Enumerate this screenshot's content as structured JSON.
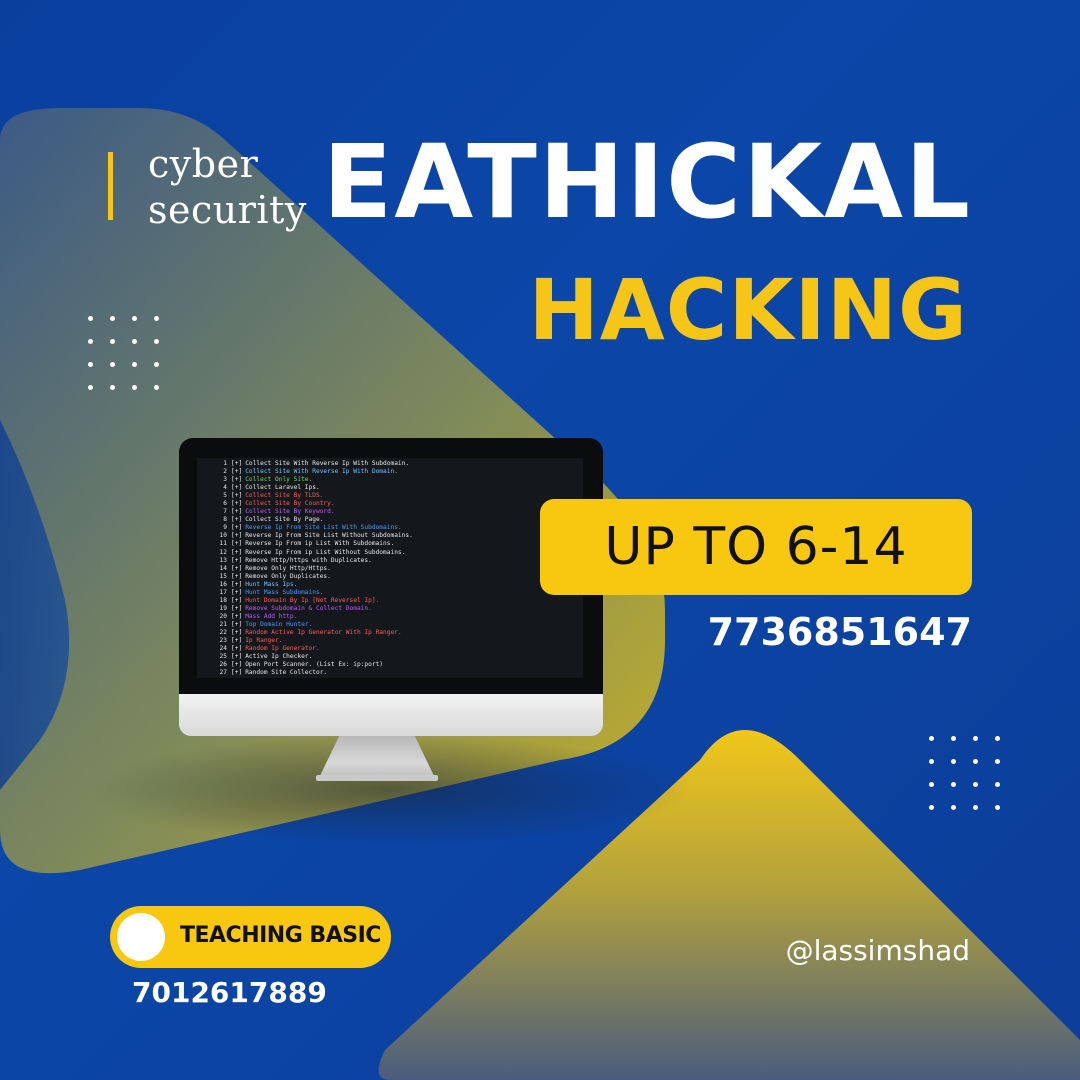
{
  "tagline": {
    "line1": "cyber",
    "line2": "security"
  },
  "title": {
    "line1": "EATHICKAL",
    "line2": "HACKING"
  },
  "age_badge": "UP TO 6-14",
  "phone_primary": "7736851647",
  "teaching_badge": "TEACHING BASIC",
  "phone_secondary": "7012617889",
  "handle": "@lassimshad",
  "colors": {
    "background_blue": "#0b47a8",
    "accent_yellow": "#f8c710",
    "text_white": "#ffffff"
  },
  "terminal": {
    "lines": [
      {
        "num": "1",
        "bracket": "[+]",
        "text": "Collect Site With Reverse Ip With Subdomain.",
        "color": "#e8e8e8"
      },
      {
        "num": "2",
        "bracket": "[+]",
        "text": "Collect Site With Reverse Ip With Domain.",
        "color": "#6ec6ff"
      },
      {
        "num": "3",
        "bracket": "[+]",
        "text": "Collect Only Site.",
        "color": "#7ed957"
      },
      {
        "num": "4",
        "bracket": "[+]",
        "text": "Collect Laravel Ips.",
        "color": "#e8e8e8"
      },
      {
        "num": "5",
        "bracket": "[+]",
        "text": "Collect Site By TLDS.",
        "color": "#ff5c5c"
      },
      {
        "num": "6",
        "bracket": "[+]",
        "text": "Collect Site By Country.",
        "color": "#ff5c5c"
      },
      {
        "num": "7",
        "bracket": "[+]",
        "text": "Collect Site By Keyword.",
        "color": "#c05cff"
      },
      {
        "num": "8",
        "bracket": "[+]",
        "text": "Collect Site By Page.",
        "color": "#e8e8e8"
      },
      {
        "num": "9",
        "bracket": "[+]",
        "text": "Reverse Ip From Site List With Subdomains.",
        "color": "#4a9bff"
      },
      {
        "num": "10",
        "bracket": "[+]",
        "text": "Reverse Ip From Site List Without Subdomains.",
        "color": "#e8e8e8"
      },
      {
        "num": "11",
        "bracket": "[+]",
        "text": "Reverse Ip From ip List With Subdomains.",
        "color": "#e8e8e8"
      },
      {
        "num": "12",
        "bracket": "[+]",
        "text": "Reverse Ip From ip List Without Subdomains.",
        "color": "#e8e8e8"
      },
      {
        "num": "13",
        "bracket": "[+]",
        "text": "Remove Http/https with Duplicates.",
        "color": "#e8e8e8"
      },
      {
        "num": "14",
        "bracket": "[+]",
        "text": "Remove Only Http/Https.",
        "color": "#e8e8e8"
      },
      {
        "num": "15",
        "bracket": "[+]",
        "text": "Remove Only Duplicates.",
        "color": "#e8e8e8"
      },
      {
        "num": "16",
        "bracket": "[+]",
        "text": "Hunt Mass Ips.",
        "color": "#6ec6ff"
      },
      {
        "num": "17",
        "bracket": "[+]",
        "text": "Hunt Mass Subdomains.",
        "color": "#4a9bff"
      },
      {
        "num": "18",
        "bracket": "[+]",
        "text": "Hunt Domain By Ip [Not Reversel Ip].",
        "color": "#ff5c5c"
      },
      {
        "num": "19",
        "bracket": "[+]",
        "text": "Remove Subdomain & Collect Domain.",
        "color": "#c05cff"
      },
      {
        "num": "20",
        "bracket": "[+]",
        "text": "Mass Add http.",
        "color": "#c05cff"
      },
      {
        "num": "21",
        "bracket": "[+]",
        "text": "Top Domain Hunter.",
        "color": "#4a9bff"
      },
      {
        "num": "22",
        "bracket": "[+]",
        "text": "Random Active Ip Generator With Ip Ranger.",
        "color": "#ff5c5c"
      },
      {
        "num": "23",
        "bracket": "[+]",
        "text": "Ip Ranger.",
        "color": "#ff5c5c"
      },
      {
        "num": "24",
        "bracket": "[+]",
        "text": "Random Ip Generator.",
        "color": "#ff5c5c"
      },
      {
        "num": "25",
        "bracket": "[+]",
        "text": "Active Ip Checker.",
        "color": "#e8e8e8"
      },
      {
        "num": "26",
        "bracket": "[+]",
        "text": "Open Port Scanner. (List Ex: ip:port)",
        "color": "#e8e8e8"
      },
      {
        "num": "27",
        "bracket": "[+]",
        "text": "Random Site Collector.",
        "color": "#e8e8e8"
      }
    ]
  }
}
